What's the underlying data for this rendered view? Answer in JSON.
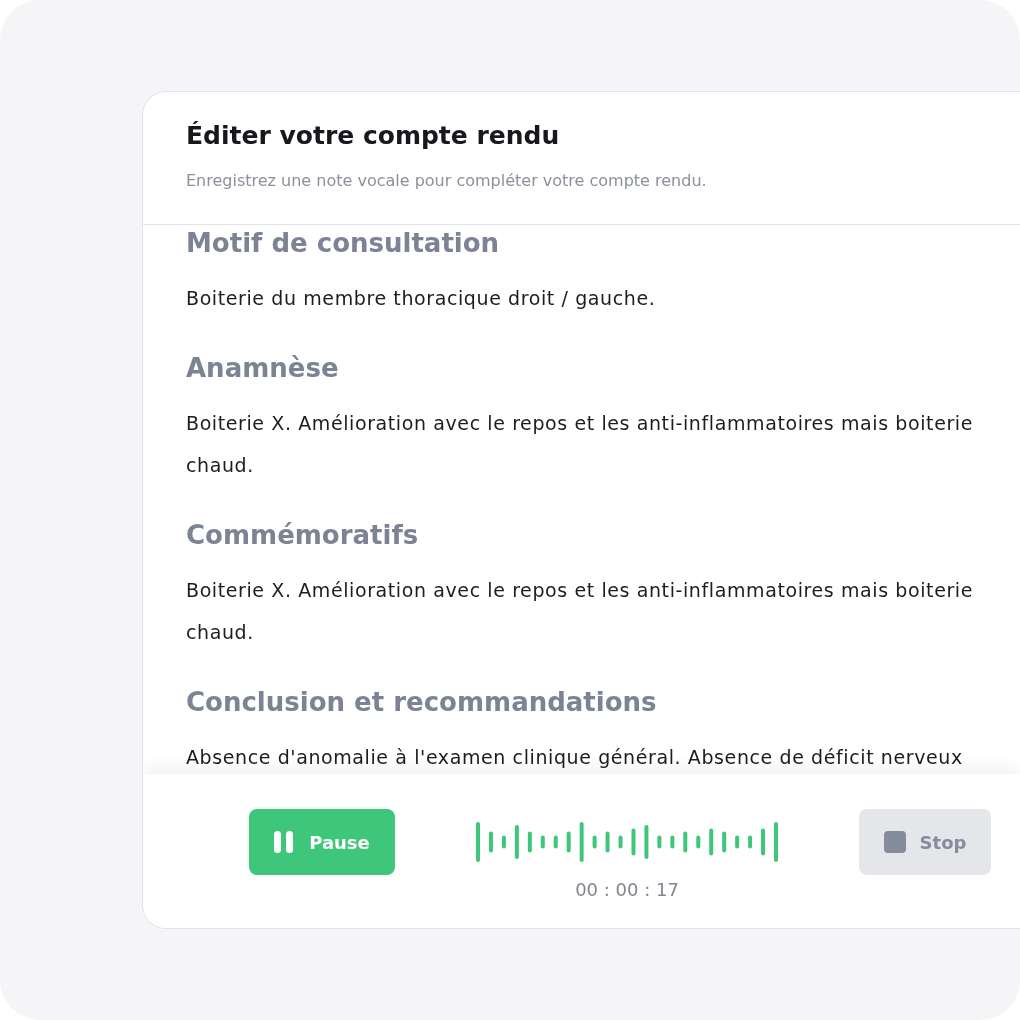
{
  "report_editor": {
    "title": "Éditer votre compte rendu",
    "subtitle": "Enregistrez une note vocale pour compléter votre compte rendu."
  },
  "sections": [
    {
      "heading": "Motif de consultation",
      "text": "Boiterie du membre thoracique droit / gauche."
    },
    {
      "heading": "Anamnèse",
      "text": "Boiterie X. Amélioration avec le repos et les anti-inflammatoires mais boiterie\nchaud."
    },
    {
      "heading": "Commémoratifs",
      "text": "Boiterie X. Amélioration avec le repos et les anti-inflammatoires mais boiterie\nchaud."
    },
    {
      "heading": "Conclusion et recommandations",
      "text": "Absence d'anomalie à l'examen clinique général. Absence de déficit nerveux"
    }
  ],
  "recorder": {
    "pause_button": {
      "label": "Pause"
    },
    "timer": "00 : 00 : 17",
    "stop_button": {
      "label": "Stop"
    }
  }
}
